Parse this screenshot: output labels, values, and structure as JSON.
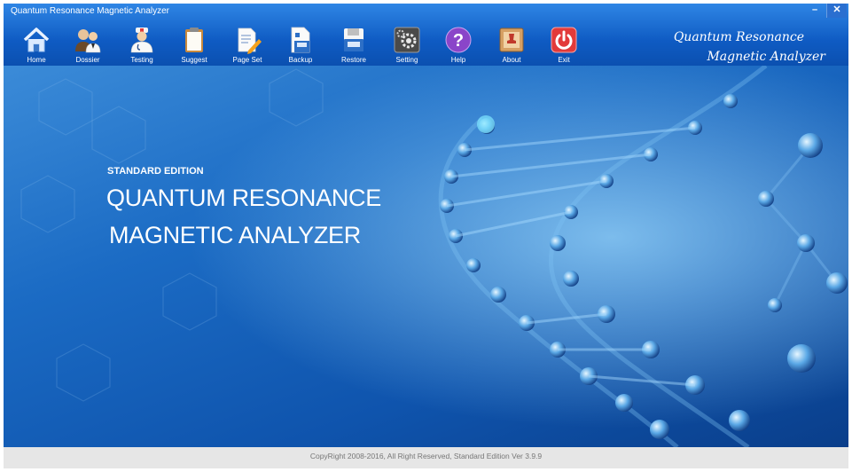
{
  "window": {
    "title": "Quantum Resonance Magnetic Analyzer",
    "minimize_glyph": "–",
    "close_glyph": "✕"
  },
  "toolbar": {
    "items": [
      {
        "label": "Home",
        "icon": "home-icon"
      },
      {
        "label": "Dossier",
        "icon": "users-icon"
      },
      {
        "label": "Testing",
        "icon": "doctor-icon"
      },
      {
        "label": "Suggest",
        "icon": "clipboard-icon"
      },
      {
        "label": "Page Set",
        "icon": "edit-document-icon"
      },
      {
        "label": "Backup",
        "icon": "backup-document-icon"
      },
      {
        "label": "Restore",
        "icon": "floppy-disk-icon"
      },
      {
        "label": "Setting",
        "icon": "gears-icon"
      },
      {
        "label": "Help",
        "icon": "question-icon"
      },
      {
        "label": "About",
        "icon": "stamp-icon"
      },
      {
        "label": "Exit",
        "icon": "power-icon"
      }
    ]
  },
  "brand": {
    "line1": "Quantum Resonance",
    "line2": "Magnetic Analyzer"
  },
  "hero": {
    "edition": "STANDARD EDITION",
    "line1": "QUANTUM RESONANCE",
    "line2": "MAGNETIC ANALYZER"
  },
  "footer": {
    "copyright": "CopyRight 2008-2016, All Right Reserved,  Standard Edition Ver 3.9.9"
  },
  "colors": {
    "toolbar_top": "#2f86e5",
    "toolbar_bottom": "#0b50b0",
    "background": "#1b6bc4",
    "footer": "#e6e6e6"
  }
}
